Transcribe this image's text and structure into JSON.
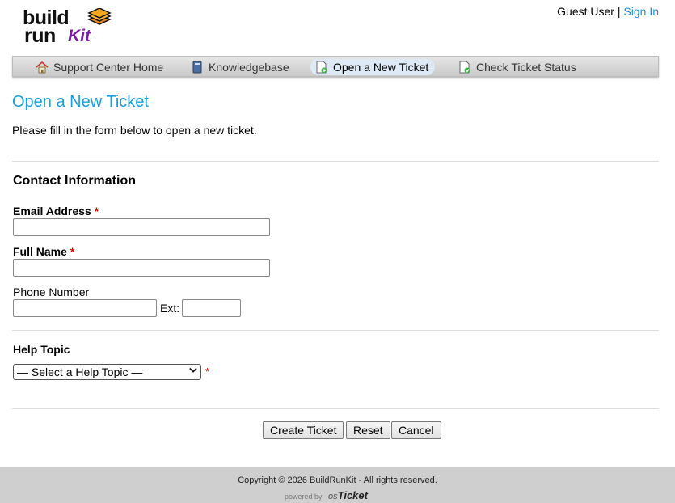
{
  "brand": {
    "line1": "build",
    "line2": "run",
    "line3": "Kit"
  },
  "userbar": {
    "guest": "Guest User",
    "separator": "|",
    "signin": "Sign In"
  },
  "nav": [
    {
      "label": "Support Center Home",
      "icon": "home-icon"
    },
    {
      "label": "Knowledgebase",
      "icon": "book-icon"
    },
    {
      "label": "Open a New Ticket",
      "icon": "new-ticket-icon",
      "active": true
    },
    {
      "label": "Check Ticket Status",
      "icon": "ticket-status-icon"
    }
  ],
  "page": {
    "title": "Open a New Ticket",
    "intro": "Please fill in the form below to open a new ticket."
  },
  "contact": {
    "heading": "Contact Information",
    "email_label": "Email Address",
    "fullname_label": "Full Name",
    "phone_label": "Phone Number",
    "ext_label": "Ext:",
    "required_marker": "*",
    "email_value": "",
    "fullname_value": "",
    "phone_value": "",
    "ext_value": ""
  },
  "help_topic": {
    "label": "Help Topic",
    "selected": "— Select a Help Topic —"
  },
  "buttons": {
    "create": "Create Ticket",
    "reset": "Reset",
    "cancel": "Cancel"
  },
  "footer": {
    "copyright": "Copyright © 2026 BuildRunKit - All rights reserved.",
    "powered_by": "powered by",
    "os": "os",
    "ticket": "Ticket"
  },
  "colors": {
    "accent": "#1a9ed9",
    "required": "#dd0000",
    "brand_purple": "#7b1fa2"
  }
}
